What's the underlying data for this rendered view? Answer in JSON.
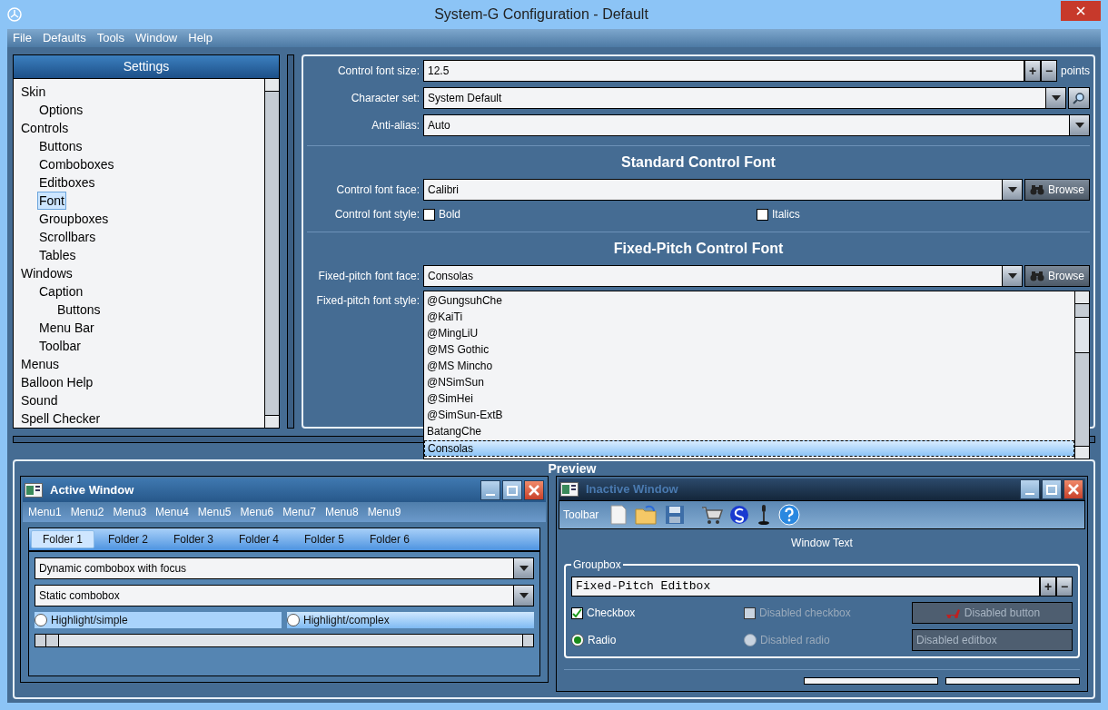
{
  "window": {
    "title": "System-G Configuration - Default"
  },
  "menu": [
    "File",
    "Defaults",
    "Tools",
    "Window",
    "Help"
  ],
  "settings": {
    "title": "Settings",
    "tree": [
      {
        "label": "Skin",
        "selected": false,
        "children": [
          {
            "label": "Options",
            "selected": false
          }
        ]
      },
      {
        "label": "Controls",
        "selected": false,
        "children": [
          {
            "label": "Buttons",
            "selected": false
          },
          {
            "label": "Comboboxes",
            "selected": false
          },
          {
            "label": "Editboxes",
            "selected": false
          },
          {
            "label": "Font",
            "selected": true
          },
          {
            "label": "Groupboxes",
            "selected": false
          },
          {
            "label": "Scrollbars",
            "selected": false
          },
          {
            "label": "Tables",
            "selected": false
          }
        ]
      },
      {
        "label": "Windows",
        "selected": false,
        "children": [
          {
            "label": "Caption",
            "selected": false,
            "children": [
              {
                "label": "Buttons",
                "selected": false
              }
            ]
          },
          {
            "label": "Menu Bar",
            "selected": false
          },
          {
            "label": "Toolbar",
            "selected": false
          }
        ]
      },
      {
        "label": "Menus",
        "selected": false
      },
      {
        "label": "Balloon Help",
        "selected": false
      },
      {
        "label": "Sound",
        "selected": false
      },
      {
        "label": "Spell Checker",
        "selected": false
      }
    ]
  },
  "font_size": {
    "label": "Control font size:",
    "value": "12.5",
    "plus": "+",
    "minus": "−",
    "unit": "points"
  },
  "character_set": {
    "label": "Character set:",
    "value": "System Default"
  },
  "anti_alias": {
    "label": "Anti-alias:",
    "value": "Auto"
  },
  "standard_font": {
    "heading": "Standard Control Font",
    "face_label": "Control font face:",
    "face": "Calibri",
    "browse": "Browse",
    "style_label": "Control font style:",
    "options": [
      {
        "label": "Bold",
        "checked": false
      },
      {
        "label": "Italics",
        "checked": false
      }
    ]
  },
  "fixed_font": {
    "heading": "Fixed-Pitch Control Font",
    "face_label": "Fixed-pitch font face:",
    "face": "Consolas",
    "browse": "Browse",
    "style_label": "Fixed-pitch font style:"
  },
  "font_list": [
    {
      "label": "@GungsuhChe",
      "selected": false
    },
    {
      "label": "@KaiTi",
      "selected": false
    },
    {
      "label": "@MingLiU",
      "selected": false
    },
    {
      "label": "@MS Gothic",
      "selected": false
    },
    {
      "label": "@MS Mincho",
      "selected": false
    },
    {
      "label": "@NSimSun",
      "selected": false
    },
    {
      "label": "@SimHei",
      "selected": false
    },
    {
      "label": "@SimSun-ExtB",
      "selected": false
    },
    {
      "label": "BatangChe",
      "selected": false
    },
    {
      "label": "Consolas",
      "selected": true
    }
  ],
  "preview": {
    "title": "Preview",
    "active_window": {
      "title": "Active Window",
      "menus": [
        "Menu1",
        "Menu2",
        "Menu3",
        "Menu4",
        "Menu5",
        "Menu6",
        "Menu7",
        "Menu8",
        "Menu9"
      ],
      "tabs": [
        {
          "label": "Folder 1",
          "selected": true
        },
        {
          "label": "Folder 2",
          "selected": false
        },
        {
          "label": "Folder 3",
          "selected": false
        },
        {
          "label": "Folder 4",
          "selected": false
        },
        {
          "label": "Folder 5",
          "selected": false
        },
        {
          "label": "Folder 6",
          "selected": false
        }
      ],
      "combos": [
        "Dynamic combobox with focus",
        "Static combobox"
      ],
      "radios": [
        {
          "label": "Highlight/simple",
          "selected": false
        },
        {
          "label": "Highlight/complex",
          "selected": false
        }
      ]
    },
    "inactive_window": {
      "title": "Inactive Window",
      "toolbar_label": "Toolbar",
      "window_text": "Window Text",
      "groupbox": {
        "title": "Groupbox",
        "editbox": "Fixed-Pitch Editbox",
        "plus": "+",
        "minus": "−",
        "controls": [
          {
            "kind": "checkbox",
            "label": "Checkbox",
            "checked": true,
            "disabled": false
          },
          {
            "kind": "checkbox",
            "label": "Disabled checkbox",
            "checked": false,
            "disabled": true
          },
          {
            "kind": "button",
            "label": "Disabled button",
            "disabled": true
          },
          {
            "kind": "radio",
            "label": "Radio",
            "checked": true,
            "disabled": false
          },
          {
            "kind": "radio",
            "label": "Disabled radio",
            "checked": false,
            "disabled": true
          },
          {
            "kind": "editbox",
            "label": "Disabled editbox",
            "disabled": true
          }
        ]
      }
    }
  }
}
